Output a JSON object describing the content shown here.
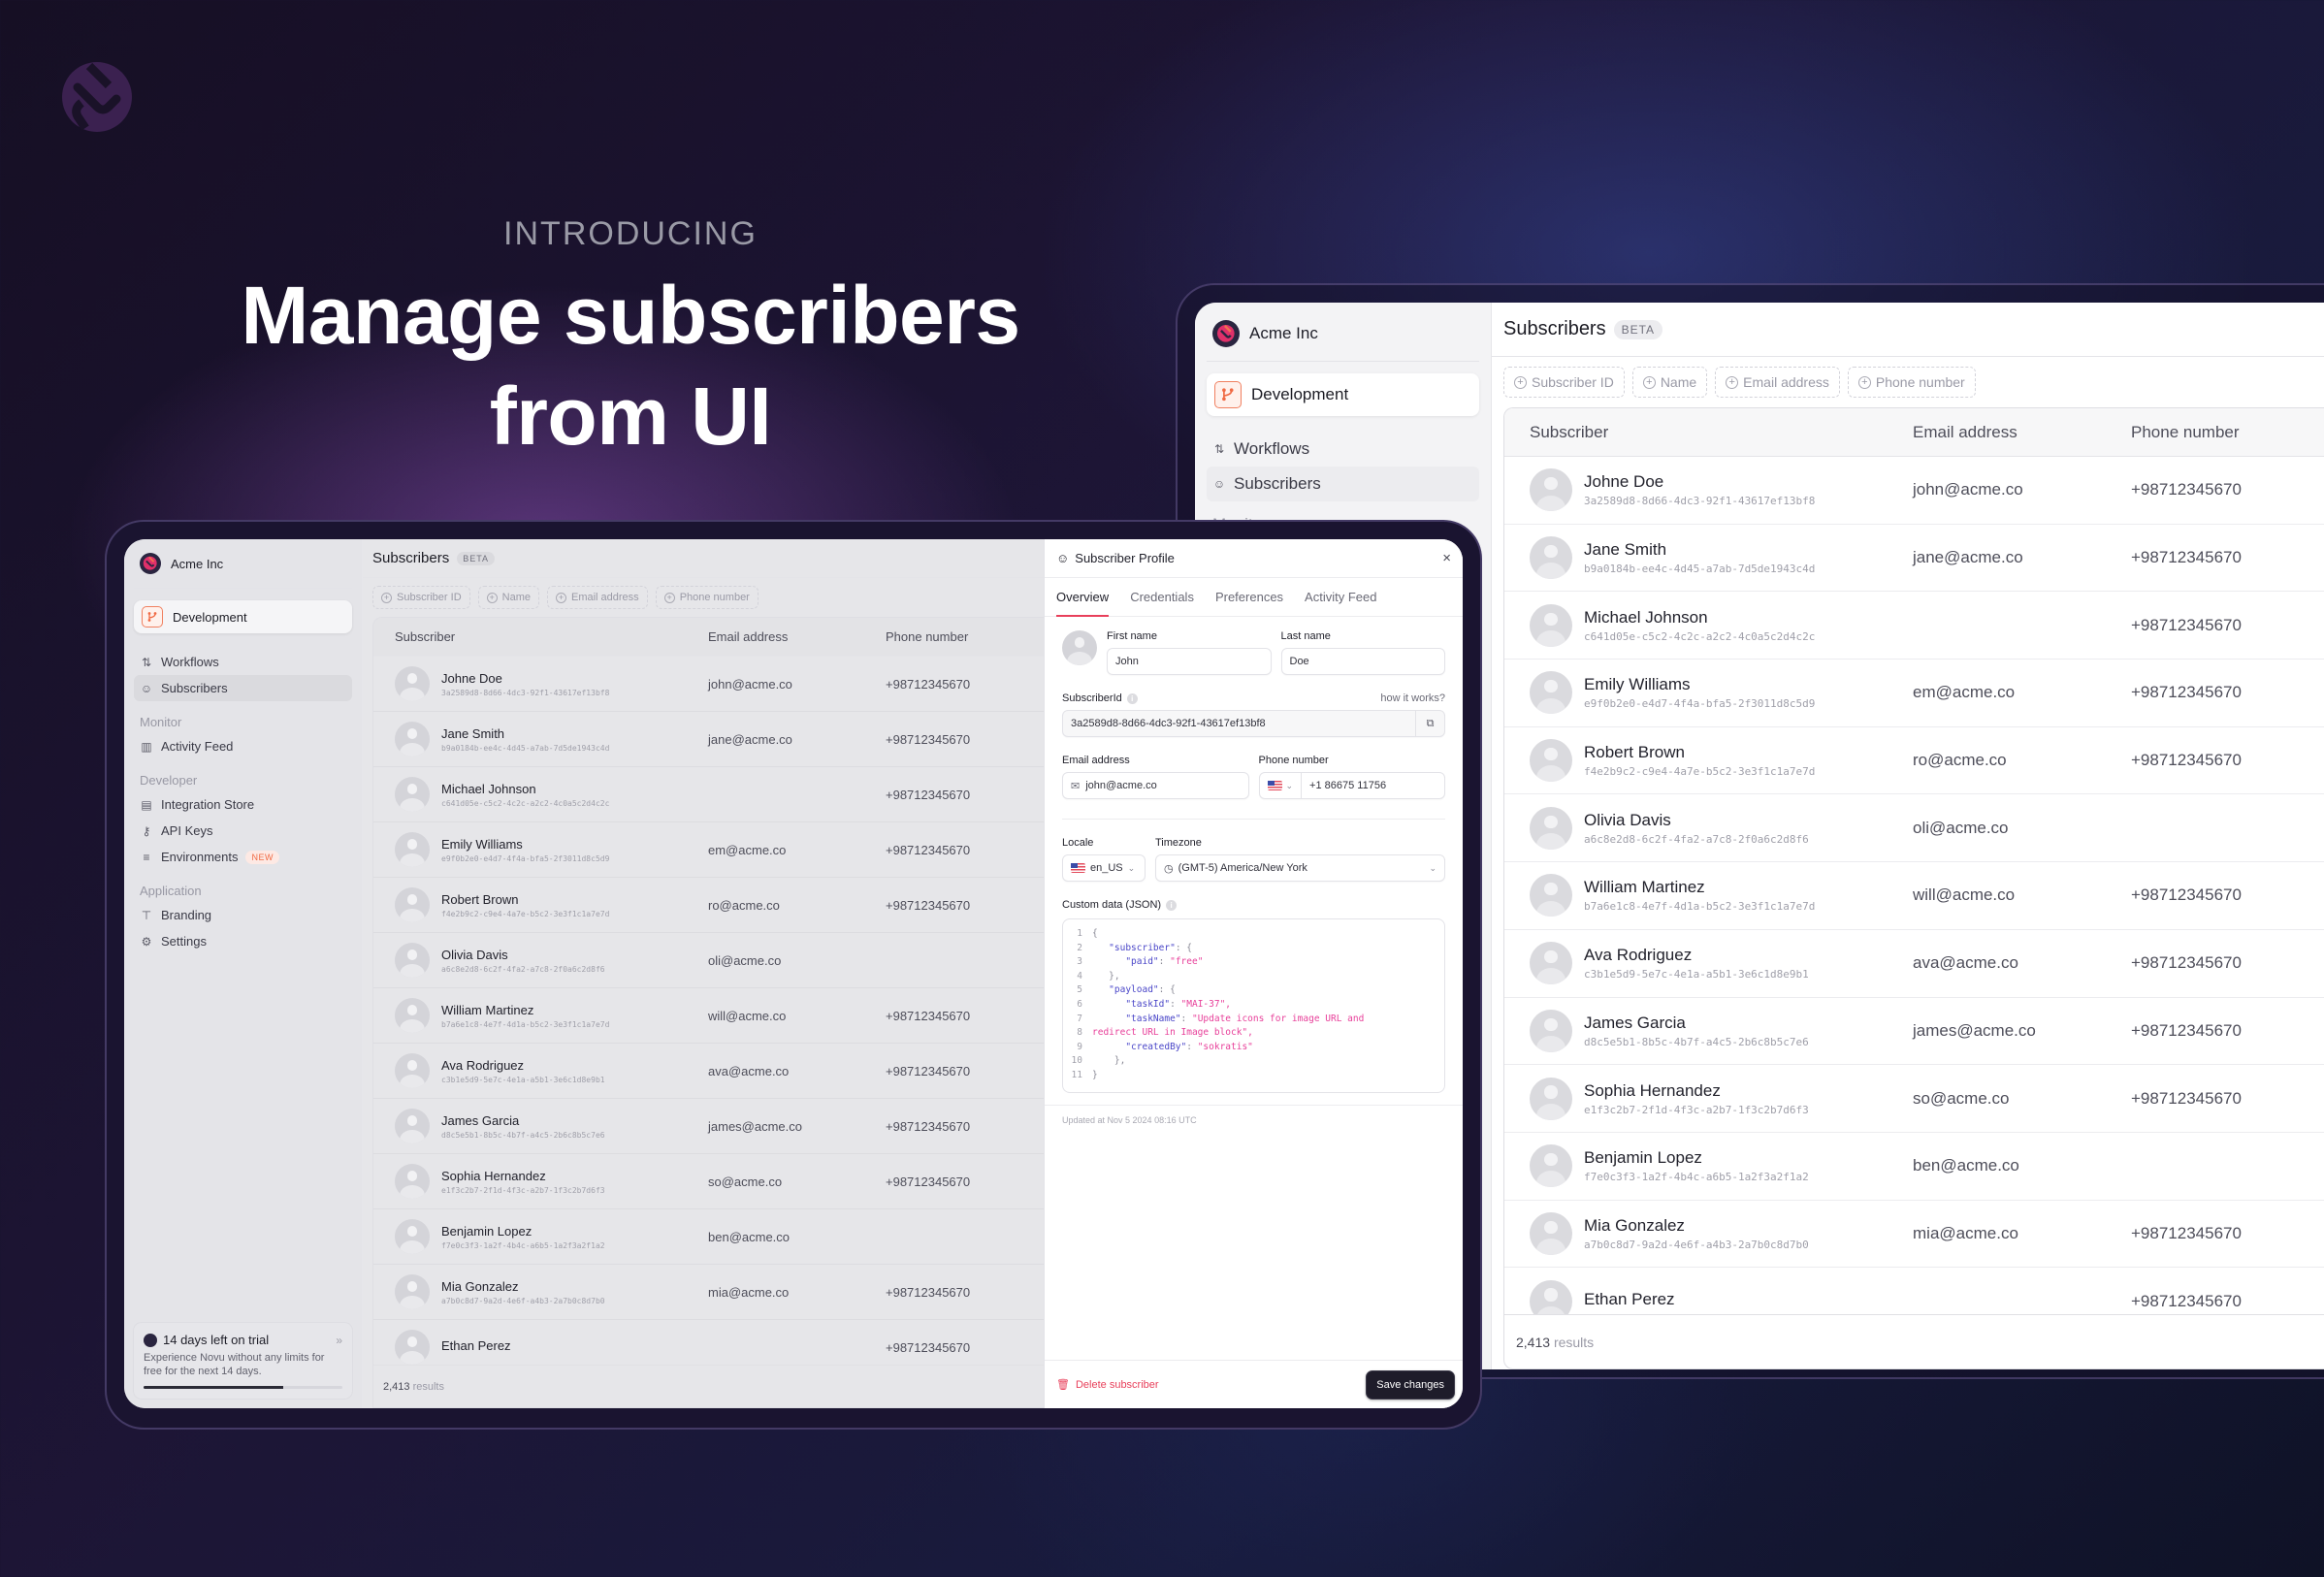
{
  "hero": {
    "eyebrow": "INTRODUCING",
    "title_line1": "Manage subscribers",
    "title_line2": "from UI"
  },
  "colors": {
    "accent": "#e8405b",
    "env_orange": "#f06a44",
    "code_key": "#4a46c8",
    "code_string": "#e8409a",
    "button_dark": "#1e1c2a"
  },
  "app": {
    "org_name": "Acme Inc",
    "environment": "Development",
    "page_title": "Subscribers",
    "page_badge": "BETA",
    "nav": {
      "primary": [
        {
          "label": "Workflows",
          "icon": "workflow-icon"
        },
        {
          "label": "Subscribers",
          "icon": "subscribers-icon",
          "active": true
        }
      ],
      "sections": [
        {
          "title": "Monitor",
          "items": [
            {
              "label": "Activity Feed",
              "icon": "chart-icon"
            }
          ]
        },
        {
          "title": "Developer",
          "items": [
            {
              "label": "Integration Store",
              "icon": "store-icon"
            },
            {
              "label": "API Keys",
              "icon": "key-icon"
            },
            {
              "label": "Environments",
              "icon": "database-icon",
              "badge": "NEW"
            }
          ]
        },
        {
          "title": "Application",
          "items": [
            {
              "label": "Branding",
              "icon": "paint-roller-icon"
            },
            {
              "label": "Settings",
              "icon": "gear-icon"
            }
          ]
        }
      ]
    },
    "trial": {
      "title": "14 days left on trial",
      "description": "Experience Novu without any limits for free for the next 14 days.",
      "progress_fraction": 0.7
    },
    "filters": [
      "Subscriber ID",
      "Name",
      "Email address",
      "Phone number"
    ],
    "table": {
      "columns": [
        "Subscriber",
        "Email address",
        "Phone number"
      ],
      "rows": [
        {
          "name": "Johne Doe",
          "id": "3a2589d8-8d66-4dc3-92f1-43617ef13bf8",
          "email": "john@acme.co",
          "phone": "+98712345670"
        },
        {
          "name": "Jane Smith",
          "id": "b9a0184b-ee4c-4d45-a7ab-7d5de1943c4d",
          "email": "jane@acme.co",
          "phone": "+98712345670"
        },
        {
          "name": "Michael Johnson",
          "id": "c641d05e-c5c2-4c2c-a2c2-4c0a5c2d4c2c",
          "email": "",
          "phone": "+98712345670"
        },
        {
          "name": "Emily Williams",
          "id": "e9f0b2e0-e4d7-4f4a-bfa5-2f3011d8c5d9",
          "email": "em@acme.co",
          "phone": "+98712345670"
        },
        {
          "name": "Robert Brown",
          "id": "f4e2b9c2-c9e4-4a7e-b5c2-3e3f1c1a7e7d",
          "email": "ro@acme.co",
          "phone": "+98712345670"
        },
        {
          "name": "Olivia Davis",
          "id": "a6c8e2d8-6c2f-4fa2-a7c8-2f0a6c2d8f6",
          "email": "oli@acme.co",
          "phone": ""
        },
        {
          "name": "William Martinez",
          "id": "b7a6e1c8-4e7f-4d1a-b5c2-3e3f1c1a7e7d",
          "email": "will@acme.co",
          "phone": "+98712345670"
        },
        {
          "name": "Ava Rodriguez",
          "id": "c3b1e5d9-5e7c-4e1a-a5b1-3e6c1d8e9b1",
          "email": "ava@acme.co",
          "phone": "+98712345670"
        },
        {
          "name": "James Garcia",
          "id": "d8c5e5b1-8b5c-4b7f-a4c5-2b6c8b5c7e6",
          "email": "james@acme.co",
          "phone": "+98712345670"
        },
        {
          "name": "Sophia Hernandez",
          "id": "e1f3c2b7-2f1d-4f3c-a2b7-1f3c2b7d6f3",
          "email": "so@acme.co",
          "phone": "+98712345670"
        },
        {
          "name": "Benjamin Lopez",
          "id": "f7e0c3f3-1a2f-4b4c-a6b5-1a2f3a2f1a2",
          "email": "ben@acme.co",
          "phone": ""
        },
        {
          "name": "Mia Gonzalez",
          "id": "a7b0c8d7-9a2d-4e6f-a4b3-2a7b0c8d7b0",
          "email": "mia@acme.co",
          "phone": "+98712345670"
        },
        {
          "name": "Ethan Perez",
          "id": "",
          "email": "",
          "phone": "+98712345670"
        }
      ],
      "results_count": "2,413",
      "results_label": "results"
    }
  },
  "profile": {
    "title": "Subscriber Profile",
    "tabs": [
      "Overview",
      "Credentials",
      "Preferences",
      "Activity Feed"
    ],
    "active_tab": "Overview",
    "first_name_label": "First name",
    "first_name": "John",
    "last_name_label": "Last name",
    "last_name": "Doe",
    "subscriber_id_label": "SubscriberId",
    "how_it_works": "how it works?",
    "subscriber_id": "3a2589d8-8d66-4dc3-92f1-43617ef13bf8",
    "email_label": "Email address",
    "email": "john@acme.co",
    "phone_label": "Phone number",
    "phone": "+1 86675 11756",
    "locale_label": "Locale",
    "locale": "en_US",
    "timezone_label": "Timezone",
    "timezone": "(GMT-5) America/New York",
    "custom_data_label": "Custom data (JSON)",
    "custom_data_lines": [
      [
        {
          "t": "p",
          "v": "{"
        }
      ],
      [
        {
          "t": "p",
          "v": "   "
        },
        {
          "t": "k",
          "v": "\"subscriber\""
        },
        {
          "t": "p",
          "v": ": {"
        }
      ],
      [
        {
          "t": "p",
          "v": "      "
        },
        {
          "t": "k",
          "v": "\"paid\""
        },
        {
          "t": "p",
          "v": ": "
        },
        {
          "t": "s",
          "v": "\"free\""
        }
      ],
      [
        {
          "t": "p",
          "v": "   },"
        }
      ],
      [
        {
          "t": "p",
          "v": "   "
        },
        {
          "t": "k",
          "v": "\"payload\""
        },
        {
          "t": "p",
          "v": ": {"
        }
      ],
      [
        {
          "t": "p",
          "v": "      "
        },
        {
          "t": "k",
          "v": "\"taskId\""
        },
        {
          "t": "p",
          "v": ": "
        },
        {
          "t": "s",
          "v": "\"MAI-37\","
        }
      ],
      [
        {
          "t": "p",
          "v": "      "
        },
        {
          "t": "k",
          "v": "\"taskName\""
        },
        {
          "t": "p",
          "v": ": "
        },
        {
          "t": "s",
          "v": "\"Update icons for image URL and"
        }
      ],
      [
        {
          "t": "s",
          "v": "redirect URL in Image block\","
        }
      ],
      [
        {
          "t": "p",
          "v": "      "
        },
        {
          "t": "k",
          "v": "\"createdBy\""
        },
        {
          "t": "p",
          "v": ": "
        },
        {
          "t": "s",
          "v": "\"sokratis\""
        }
      ],
      [
        {
          "t": "p",
          "v": "    },"
        }
      ],
      [
        {
          "t": "p",
          "v": "}"
        }
      ]
    ],
    "updated_at": "Updated at  Nov 5 2024 08:16 UTC",
    "delete_label": "Delete subscriber",
    "save_label": "Save changes"
  }
}
